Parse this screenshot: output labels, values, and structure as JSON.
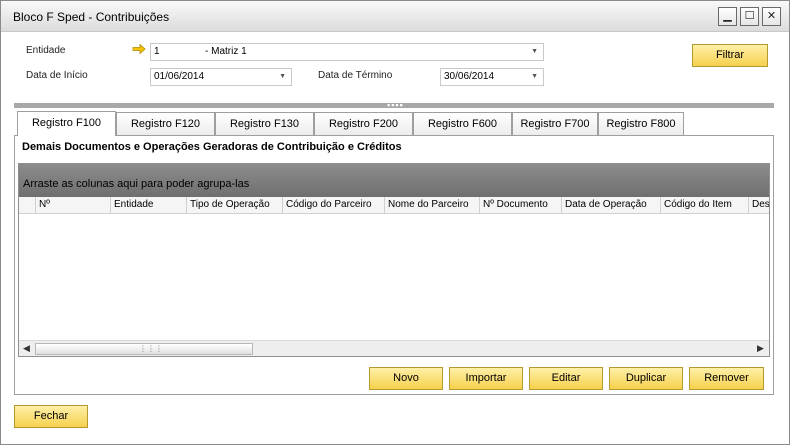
{
  "window": {
    "title": "Bloco F Sped - Contribuições"
  },
  "controls": {
    "minimize": "▁",
    "maximize": "☐",
    "close": "✕"
  },
  "form": {
    "entidade_label": "Entidade",
    "entidade_code": "1",
    "entidade_name": "- Matriz 1",
    "data_inicio_label": "Data de Início",
    "data_inicio_value": "01/06/2014",
    "data_termino_label": "Data de Término",
    "data_termino_value": "30/06/2014"
  },
  "buttons": {
    "filtrar": "Filtrar",
    "novo": "Novo",
    "importar": "Importar",
    "editar": "Editar",
    "duplicar": "Duplicar",
    "remover": "Remover",
    "fechar": "Fechar"
  },
  "tabs": [
    {
      "label": "Registro F100"
    },
    {
      "label": "Registro F120"
    },
    {
      "label": "Registro F130"
    },
    {
      "label": "Registro F200"
    },
    {
      "label": "Registro F600"
    },
    {
      "label": "Registro F700"
    },
    {
      "label": "Registro F800"
    }
  ],
  "panel": {
    "title": "Demais Documentos e Operações Geradoras de Contribuição e Créditos"
  },
  "grid": {
    "group_hint": "Arraste as colunas aqui para poder agrupa-las",
    "columns": [
      "Nº",
      "Entidade",
      "Tipo de Operação",
      "Código do Parceiro",
      "Nome do Parceiro",
      "Nº Documento",
      "Data de Operação",
      "Código do Item",
      "Des"
    ],
    "rows": []
  },
  "colors": {
    "button_yellow": "#f6d14e",
    "group_bar": "#7d7d7d",
    "splitter": "#a8a8a8"
  }
}
